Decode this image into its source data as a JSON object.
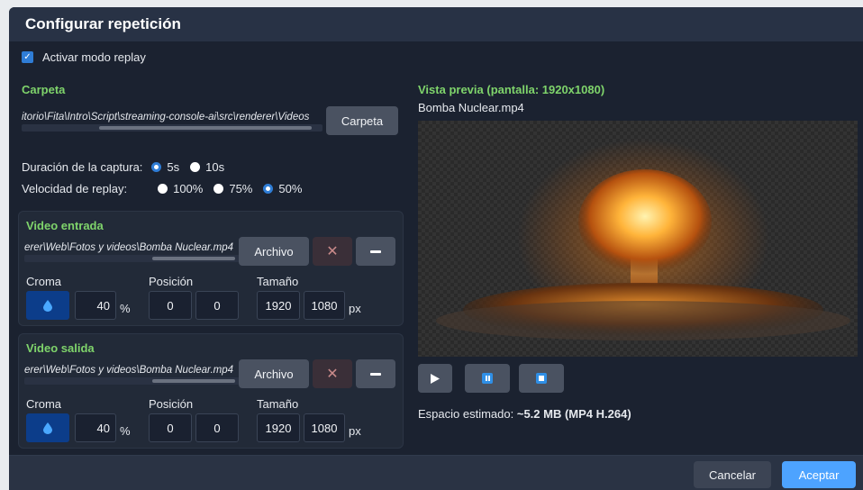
{
  "dialog": {
    "title": "Configurar repetición",
    "replay_toggle_label": "Activar modo replay",
    "replay_enabled": true
  },
  "folder": {
    "label": "Carpeta",
    "path": "itorio\\Fita\\Intro\\Script\\streaming-console-ai\\src\\renderer\\Videos",
    "button_label": "Carpeta"
  },
  "capture": {
    "duration_label": "Duración de la captura:",
    "duration_options": [
      "5s",
      "10s"
    ],
    "duration_selected": "5s",
    "speed_label": "Velocidad de replay:",
    "speed_options": [
      "100%",
      "75%",
      "50%"
    ],
    "speed_selected": "50%"
  },
  "video_in": {
    "title": "Video entrada",
    "path": "erer\\Web\\Fotos y videos\\Bomba Nuclear.mp4",
    "file_button": "Archivo",
    "chroma_label": "Croma",
    "chroma_value": "40",
    "chroma_unit": "%",
    "position_label": "Posición",
    "pos_x": "0",
    "pos_y": "0",
    "size_label": "Tamaño",
    "width": "1920",
    "height": "1080",
    "size_unit": "px"
  },
  "video_out": {
    "title": "Video salida",
    "path": "erer\\Web\\Fotos y videos\\Bomba Nuclear.mp4",
    "file_button": "Archivo",
    "chroma_label": "Croma",
    "chroma_value": "40",
    "chroma_unit": "%",
    "position_label": "Posición",
    "pos_x": "0",
    "pos_y": "0",
    "size_label": "Tamaño",
    "width": "1920",
    "height": "1080",
    "size_unit": "px"
  },
  "preview": {
    "title": "Vista previa (pantalla: 1920x1080)",
    "filename": "Bomba Nuclear.mp4",
    "estimate_label": "Espacio estimado:",
    "estimate_value": "~5.2 MB (MP4 H.264)"
  },
  "footer": {
    "cancel_label": "Cancelar",
    "accept_label": "Aceptar"
  },
  "colors": {
    "accent": "#2f7dd6",
    "section_green": "#7fd46b",
    "accept_blue": "#4da3ff",
    "chroma_swatch": "#0c3d8a"
  },
  "icons": [
    "check-icon",
    "close-icon",
    "minus-icon",
    "droplet-icon",
    "play-icon",
    "pause-icon",
    "stop-icon"
  ]
}
